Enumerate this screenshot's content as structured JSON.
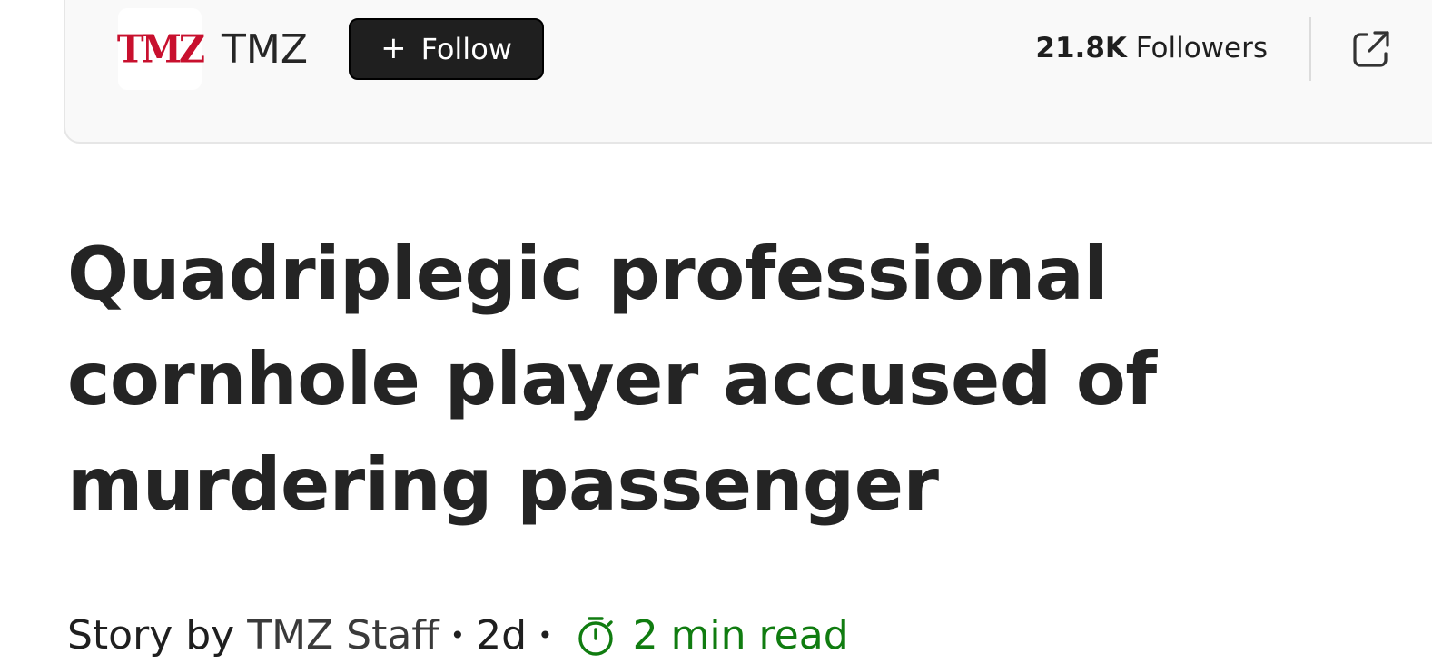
{
  "publisher": {
    "logo_text": "TMZ",
    "name": "TMZ",
    "follow_label": "Follow",
    "followers_count": "21.8K",
    "followers_label": "Followers",
    "share_icon": "open-in-new-window-icon",
    "plus_icon": "plus-icon"
  },
  "article": {
    "headline": "Quadriplegic professional cornhole player accused of murdering passenger",
    "byline_prefix": "Story by",
    "author": "TMZ Staff",
    "age": "2d",
    "read_time": "2 min read",
    "timer_icon": "timer-icon"
  },
  "colors": {
    "logo_red": "#c8102e",
    "follow_bg": "#1f1f1f",
    "read_time_green": "#107c10"
  }
}
